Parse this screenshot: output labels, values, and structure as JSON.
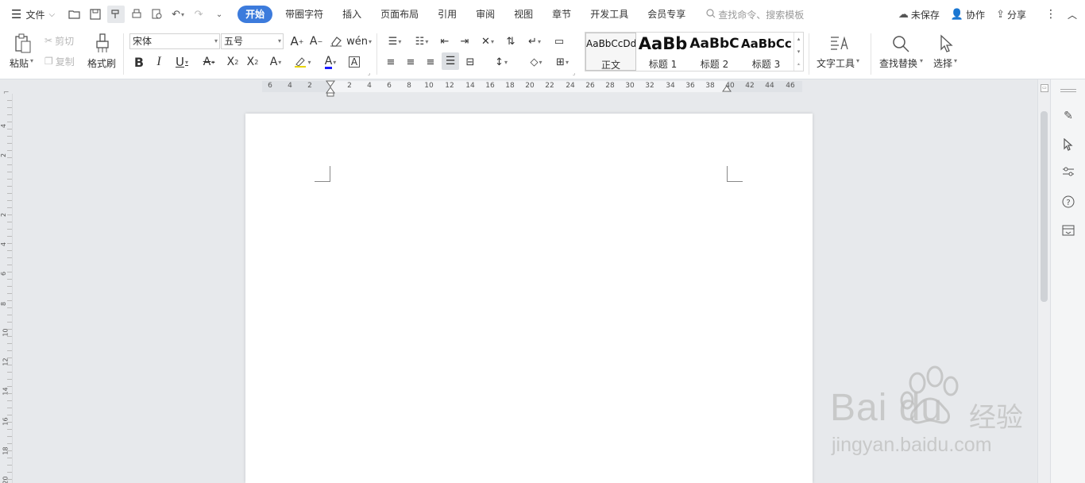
{
  "menubar": {
    "file_label": "文件",
    "tabs": [
      "开始",
      "带圈字符",
      "插入",
      "页面布局",
      "引用",
      "审阅",
      "视图",
      "章节",
      "开发工具",
      "会员专享"
    ],
    "search_placeholder": "查找命令、搜索模板",
    "unsaved_label": "未保存",
    "collab_label": "协作",
    "share_label": "分享"
  },
  "ribbon": {
    "paste_label": "粘贴",
    "cut_label": "剪切",
    "copy_label": "复制",
    "format_painter_label": "格式刷",
    "font_name": "宋体",
    "font_size": "五号",
    "styles": [
      {
        "preview": "AaBbCcDd",
        "name": "正文"
      },
      {
        "preview": "AaBb",
        "name": "标题 1"
      },
      {
        "preview": "AaBbC",
        "name": "标题 2"
      },
      {
        "preview": "AaBbCc",
        "name": "标题 3"
      }
    ],
    "text_tools_label": "文字工具",
    "find_replace_label": "查找替换",
    "select_label": "选择"
  },
  "ruler": {
    "h_ticks": [
      "6",
      "4",
      "2",
      "2",
      "4",
      "6",
      "8",
      "10",
      "12",
      "14",
      "16",
      "18",
      "20",
      "22",
      "24",
      "26",
      "28",
      "30",
      "32",
      "34",
      "36",
      "38",
      "40",
      "42",
      "44",
      "46"
    ],
    "v_ticks": [
      "4",
      "2",
      "2",
      "4",
      "6",
      "8",
      "10",
      "12",
      "14",
      "16",
      "18",
      "20"
    ]
  },
  "watermark": {
    "brand": "Bai du",
    "brand_cn": "经验",
    "url": "jingyan.baidu.com"
  },
  "colors": {
    "accent": "#3c7bdc",
    "font_color_underline": "#1a1aff"
  }
}
